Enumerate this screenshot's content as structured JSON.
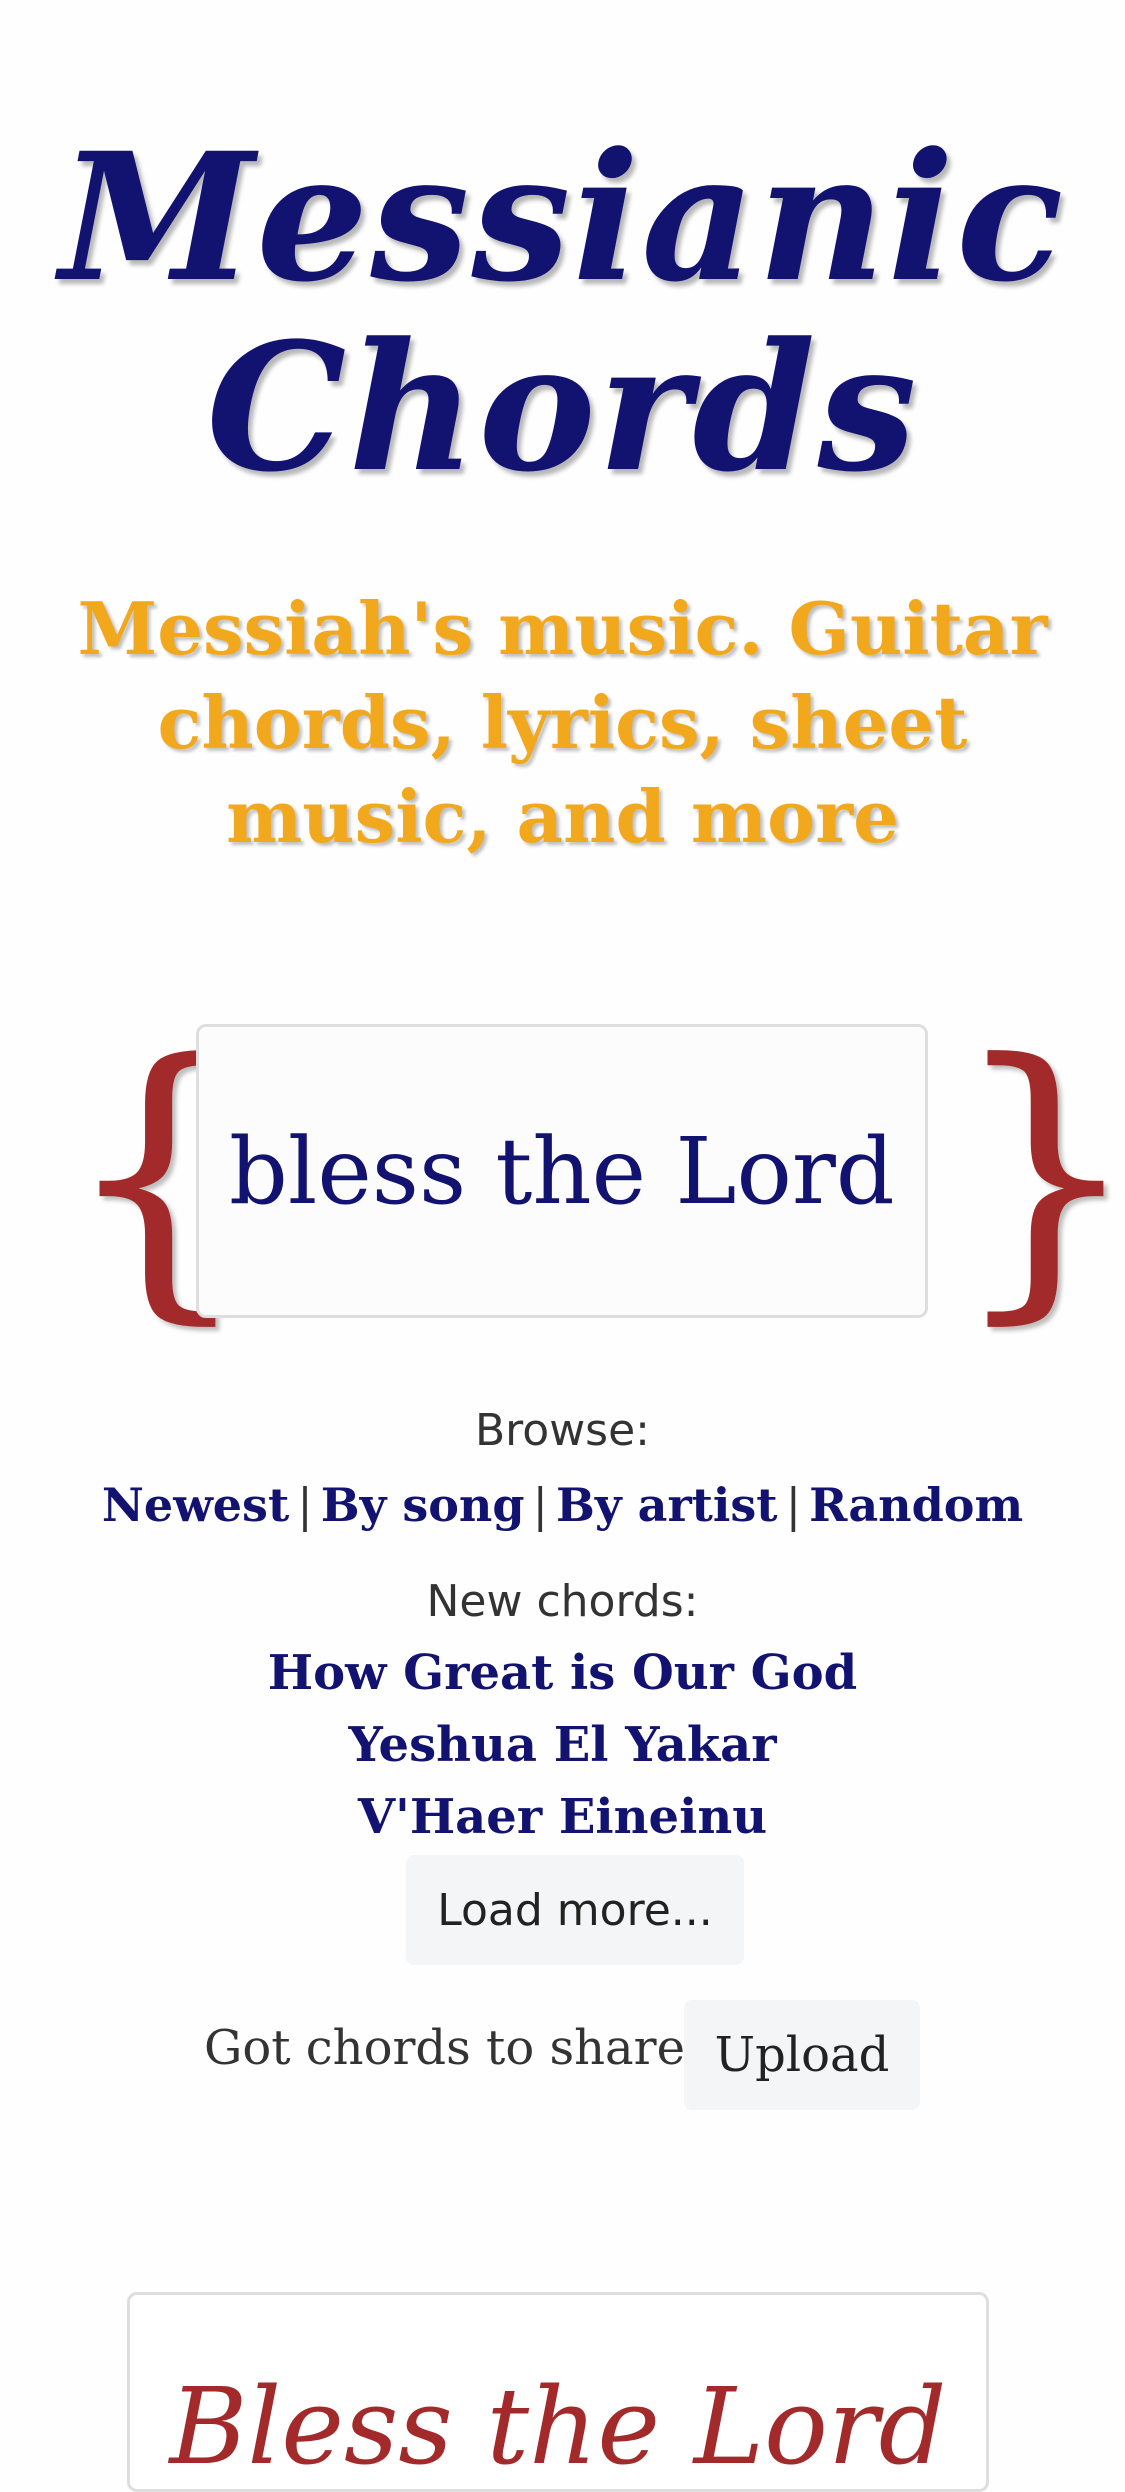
{
  "header": {
    "logo_line1": "Messianic",
    "logo_line2": "Chords",
    "tagline": "Messiah's music. Guitar chords, lyrics, sheet music, and more"
  },
  "search": {
    "left_brace": "{",
    "right_brace": "}",
    "value": "bless the Lord"
  },
  "browse": {
    "label": "Browse:",
    "links": [
      "Newest",
      "By song",
      "By artist",
      "Random"
    ],
    "separator": "|"
  },
  "new_chords": {
    "label": "New chords:",
    "songs": [
      "How Great is Our God",
      "Yeshua El Yakar",
      "V'Haer Eineinu"
    ],
    "load_more_label": "Load more..."
  },
  "share": {
    "text": "Got chords to share?",
    "upload_label": "Upload"
  },
  "featured": {
    "title": "Bless the Lord"
  },
  "colors": {
    "logo": "#121270",
    "tagline": "#f2a81c",
    "brace": "#a32a2a",
    "link": "#121270"
  }
}
